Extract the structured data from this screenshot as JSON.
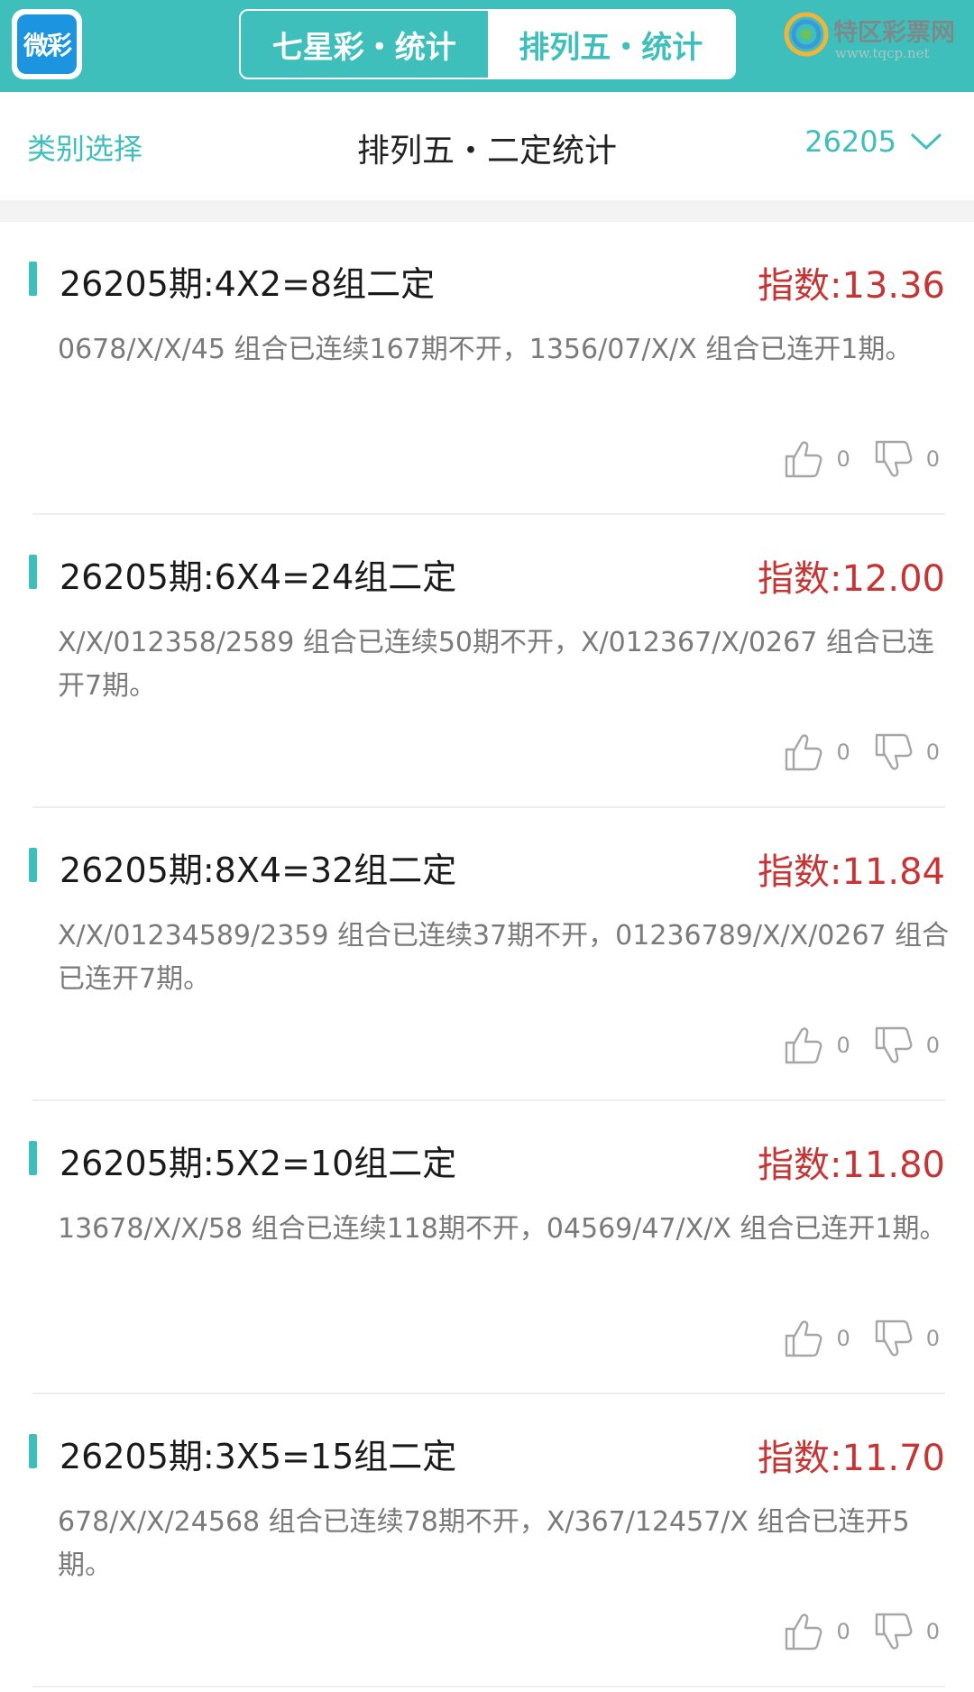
{
  "header": {
    "logo_text": "微彩",
    "tabs": [
      {
        "label": "七星彩・统计",
        "active": false
      },
      {
        "label": "排列五・统计",
        "active": true
      }
    ],
    "brand_name": "特区彩票网",
    "brand_url": "www.tqcp.net",
    "accent_color": "#3fbfbb"
  },
  "subheader": {
    "category_label": "类别选择",
    "title": "排列五・二定统计",
    "issue": "26205"
  },
  "cards": [
    {
      "title": "26205期:4X2=8组二定",
      "index": "指数:13.36",
      "desc": "0678/X/X/45 组合已连续167期不开，1356/07/X/X 组合已连开1期。",
      "likes": "0",
      "dislikes": "0"
    },
    {
      "title": "26205期:6X4=24组二定",
      "index": "指数:12.00",
      "desc": "X/X/012358/2589 组合已连续50期不开，X/012367/X/0267 组合已连开7期。",
      "likes": "0",
      "dislikes": "0"
    },
    {
      "title": "26205期:8X4=32组二定",
      "index": "指数:11.84",
      "desc": "X/X/01234589/2359 组合已连续37期不开，01236789/X/X/0267 组合已连开7期。",
      "likes": "0",
      "dislikes": "0"
    },
    {
      "title": "26205期:5X2=10组二定",
      "index": "指数:11.80",
      "desc": "13678/X/X/58 组合已连续118期不开，04569/47/X/X 组合已连开1期。",
      "likes": "0",
      "dislikes": "0"
    },
    {
      "title": "26205期:3X5=15组二定",
      "index": "指数:11.70",
      "desc": "678/X/X/24568 组合已连续78期不开，X/367/12457/X 组合已连开5期。",
      "likes": "0",
      "dislikes": "0"
    }
  ]
}
